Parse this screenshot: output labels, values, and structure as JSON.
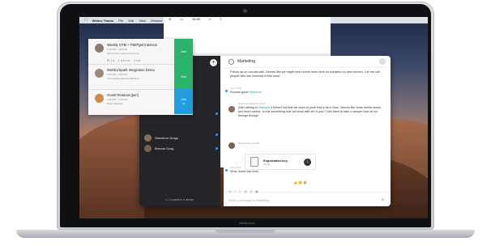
{
  "menubar": {
    "app_name": "Webex Teams",
    "items": [
      "File",
      "Edit",
      "View",
      "Window",
      "Help"
    ],
    "clock": "06:00"
  },
  "notifications": [
    {
      "title": "Weekly GTM + PM/PgM Interlock",
      "time": "1:00 PM - 2:00 PM",
      "detail": "https://cisco.webex.com/meet",
      "detail2": "Rita, Leslie, Jim",
      "action": "Join",
      "color": "#2bb26b"
    },
    {
      "title": "WebEx/Spark Integration Demo",
      "time": "1:00 PM - 2:00 PM",
      "detail": "Cisco Spark Meeting (Builder)",
      "detail2": "",
      "action": "Join",
      "color": "#2bb26b"
    },
    {
      "title": "Guest Readout (pen)",
      "time": "1:00 PM - 1:30 PM",
      "detail": "Board Meeting",
      "detail2": "",
      "action": "Join",
      "color": "#1e9ede"
    }
  ],
  "spaces": [
    {
      "name": "Wanderer Drugs",
      "dot": false
    },
    {
      "name": "Brenda Song",
      "dot": true
    }
  ],
  "sidebar_footer": "Connect to a device",
  "space": {
    "title": "Marketing"
  },
  "messages": [
    {
      "text": "Follow up on our last talk. Seems like we might need some more time on transition to new servers. Let me call people who are involved in this soon.",
      "author": "",
      "time": ""
    },
    {
      "author": "You",
      "time": "10:49",
      "text": "Sounds good",
      "mention": "Giacomo."
    },
    {
      "author": "Giacomo Edwards",
      "time": "12:34",
      "text_pre": "After talking to",
      "mention": "Barbara",
      "text_post": "it turned out that we need to push this a bit in time. Seems like team needs about two more weeks. Is this something that will work with all of you? I still have to take a deeper look at our timings though."
    },
    {
      "author": "Brenda Song",
      "time": "13:00",
      "text": ""
    },
    {
      "author": "You",
      "time": "13:11",
      "text": "Wow, these are nice!"
    }
  ],
  "file": {
    "name": "Exploration.key",
    "size": "24 KB"
  },
  "reactions": "👍🙂🎉",
  "composer": {
    "placeholder": "Write a message to Marketing"
  },
  "laptop_label": "MacBook Air"
}
